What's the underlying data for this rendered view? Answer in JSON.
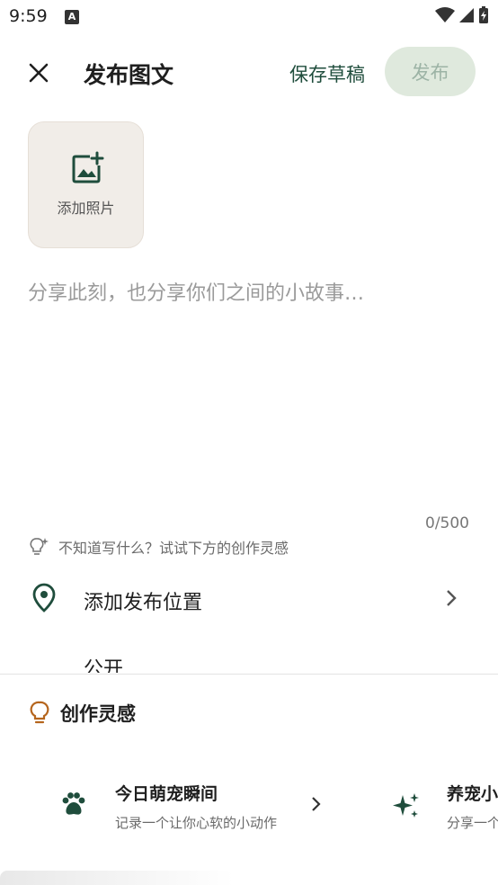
{
  "status_bar": {
    "time": "9:59",
    "notification_badge": "A"
  },
  "header": {
    "close_icon": "close-icon",
    "title": "发布图文",
    "save_draft_label": "保存草稿",
    "publish_label": "发布"
  },
  "photo": {
    "add_label": "添加照片",
    "icon": "add-photo-icon"
  },
  "editor": {
    "placeholder": "分享此刻，也分享你们之间的小故事…",
    "value": "",
    "char_count": "0/500"
  },
  "tip": {
    "text": "不知道写什么？试试下方的创作灵感",
    "icon": "lightbulb-sparkle-icon"
  },
  "location": {
    "label": "添加发布位置",
    "icon": "map-pin-icon"
  },
  "visibility": {
    "label": "公开"
  },
  "inspiration": {
    "title": "创作灵感",
    "cards": [
      {
        "title": "今日萌宠瞬间",
        "desc": "记录一个让你心软的小动作",
        "icon": "paw-icon"
      },
      {
        "title": "养宠小",
        "desc": "分享一个",
        "icon": "sparkle-icon"
      }
    ]
  },
  "colors": {
    "brand_green": "#1f4d3c",
    "publish_bg": "#dfe9dd",
    "publish_text": "#9cb3a5",
    "photo_bg": "#f1ede8",
    "inspiration_icon": "#b5651d"
  }
}
